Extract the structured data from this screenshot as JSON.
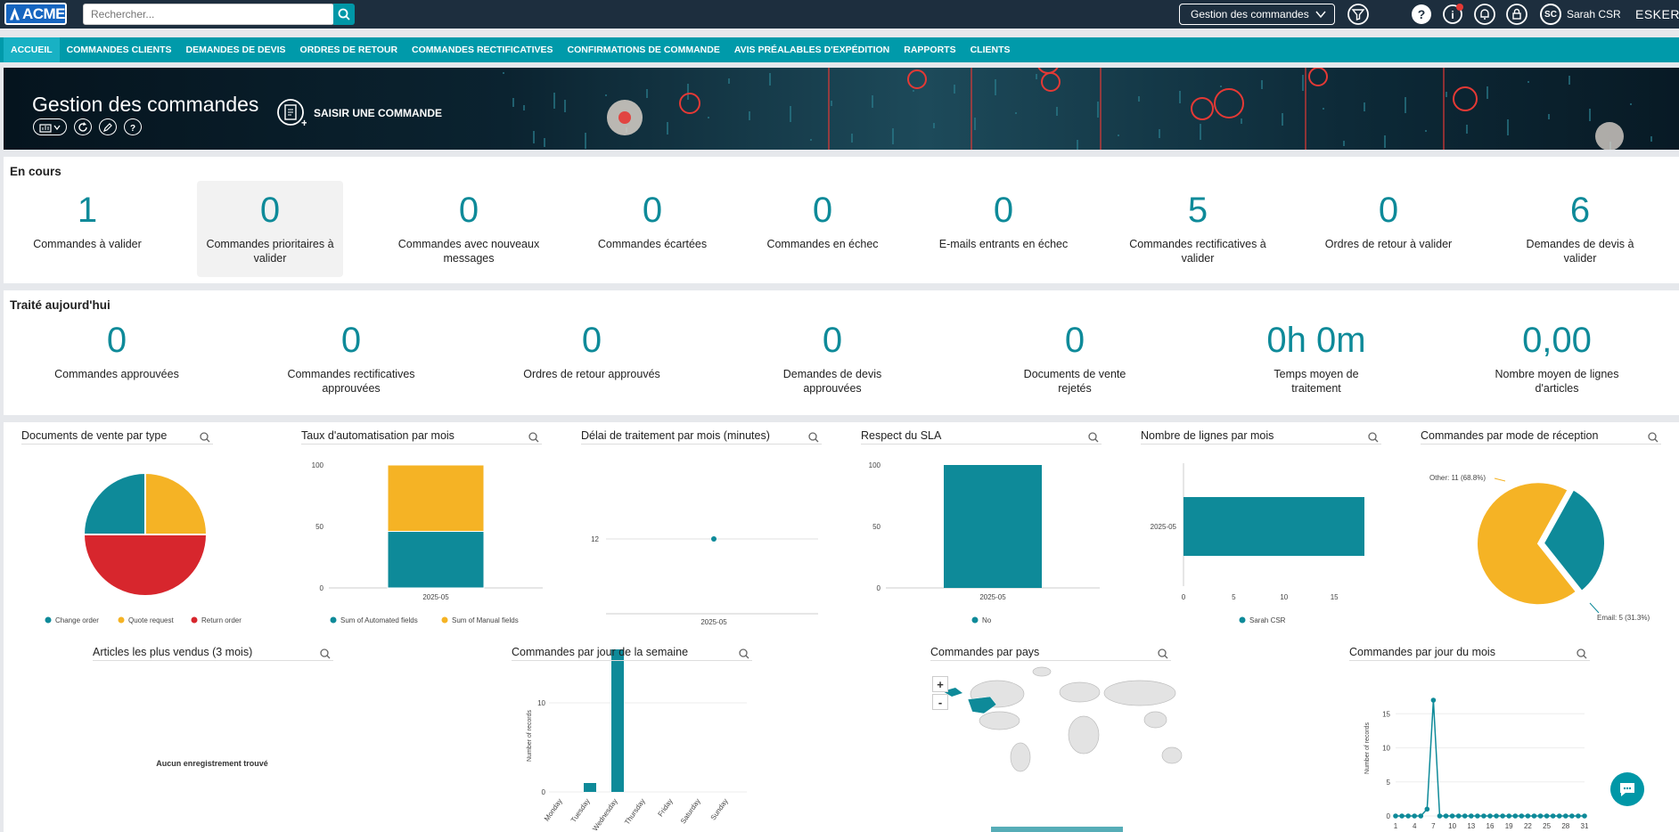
{
  "header": {
    "logo_text": "ACME",
    "search_placeholder": "Rechercher...",
    "app_selector": "Gestion des commandes",
    "user_initials": "SC",
    "user_name": "Sarah CSR",
    "brand": "ESKER"
  },
  "nav": {
    "items": [
      "ACCUEIL",
      "COMMANDES CLIENTS",
      "DEMANDES DE DEVIS",
      "ORDRES DE RETOUR",
      "COMMANDES RECTIFICATIVES",
      "CONFIRMATIONS DE COMMANDE",
      "AVIS PRÉALABLES D'EXPÉDITION",
      "RAPPORTS",
      "CLIENTS"
    ],
    "active_index": 0
  },
  "banner": {
    "title": "Gestion des commandes",
    "action_label": "SAISIR UNE COMMANDE"
  },
  "en_cours": {
    "title": "En cours",
    "kpis": [
      {
        "value": "1",
        "label": "Commandes à valider"
      },
      {
        "value": "0",
        "label": "Commandes prioritaires à valider"
      },
      {
        "value": "0",
        "label": "Commandes avec nouveaux messages"
      },
      {
        "value": "0",
        "label": "Commandes écartées"
      },
      {
        "value": "0",
        "label": "Commandes en échec"
      },
      {
        "value": "0",
        "label": "E-mails entrants en échec"
      },
      {
        "value": "5",
        "label": "Commandes rectificatives à valider"
      },
      {
        "value": "0",
        "label": "Ordres de retour à valider"
      },
      {
        "value": "6",
        "label": "Demandes de devis à valider"
      }
    ]
  },
  "traite": {
    "title": "Traité aujourd'hui",
    "kpis": [
      {
        "value": "0",
        "label": "Commandes approuvées"
      },
      {
        "value": "0",
        "label": "Commandes rectificatives approuvées"
      },
      {
        "value": "0",
        "label": "Ordres de retour approuvés"
      },
      {
        "value": "0",
        "label": "Demandes de devis approuvées"
      },
      {
        "value": "0",
        "label": "Documents de vente rejetés"
      },
      {
        "value": "0h 0m",
        "label": "Temps moyen de traitement"
      },
      {
        "value": "0,00",
        "label": "Nombre moyen de lignes d'articles"
      }
    ]
  },
  "charts": {
    "c1": {
      "title": "Documents de vente par type"
    },
    "c2": {
      "title": "Taux d'automatisation par mois"
    },
    "c3": {
      "title": "Délai de traitement par mois (minutes)"
    },
    "c4": {
      "title": "Respect du SLA"
    },
    "c5": {
      "title": "Nombre de lignes par mois"
    },
    "c6": {
      "title": "Commandes par mode de réception"
    },
    "c7": {
      "title": "Articles les plus vendus (3 mois)",
      "empty": "Aucun enregistrement trouvé"
    },
    "c8": {
      "title": "Commandes par jour de la semaine"
    },
    "c9": {
      "title": "Commandes par pays"
    },
    "c10": {
      "title": "Commandes par jour du mois"
    }
  },
  "colors": {
    "teal": "#0e8a99",
    "yellow": "#f5b325",
    "red": "#d7262d",
    "nav": "#009aaa",
    "topbar": "#1d2e3e"
  },
  "chart_data": [
    {
      "type": "pie",
      "title": "Documents de vente par type",
      "categories": [
        "Change order",
        "Quote request",
        "Return order"
      ],
      "values": [
        25,
        25,
        50
      ],
      "colors": [
        "#0e8a99",
        "#f5b325",
        "#d7262d"
      ],
      "legend": "bottom"
    },
    {
      "type": "bar",
      "title": "Taux d'automatisation par mois",
      "categories": [
        "2025-05"
      ],
      "series": [
        {
          "name": "Sum of Automated fields",
          "values": [
            46
          ]
        },
        {
          "name": "Sum of Manual fields",
          "values": [
            54
          ]
        }
      ],
      "stacked": true,
      "ylim": [
        0,
        100
      ],
      "yticks": [
        0,
        50,
        100
      ],
      "legend": "bottom"
    },
    {
      "type": "line",
      "title": "Délai de traitement par mois (minutes)",
      "categories": [
        "2025-05"
      ],
      "values": [
        12
      ],
      "yticks": [
        12
      ]
    },
    {
      "type": "bar",
      "title": "Respect du SLA",
      "categories": [
        "2025-05"
      ],
      "series": [
        {
          "name": "No",
          "values": [
            100
          ]
        }
      ],
      "ylim": [
        0,
        100
      ],
      "yticks": [
        0,
        50,
        100
      ],
      "legend": "bottom"
    },
    {
      "type": "bar",
      "title": "Nombre de lignes par mois",
      "orientation": "horizontal",
      "categories": [
        "2025-05"
      ],
      "series": [
        {
          "name": "Sarah CSR",
          "values": [
            18
          ]
        }
      ],
      "xlim": [
        0,
        18
      ],
      "xticks": [
        0,
        5,
        10,
        15
      ],
      "legend": "bottom"
    },
    {
      "type": "pie",
      "title": "Commandes par mode de réception",
      "categories": [
        "Other",
        "Email"
      ],
      "values": [
        11,
        5
      ],
      "labels": [
        "Other: 11 (68.8%)",
        "Email: 5 (31.3%)"
      ],
      "colors": [
        "#f5b325",
        "#0e8a99"
      ]
    },
    {
      "type": "bar",
      "title": "Commandes par jour de la semaine",
      "categories": [
        "Monday",
        "Tuesday",
        "Wednesday",
        "Thursday",
        "Friday",
        "Saturday",
        "Sunday"
      ],
      "values": [
        0,
        1,
        16,
        0,
        0,
        0,
        0
      ],
      "ylabel": "Number of records",
      "ylim": [
        0,
        17
      ],
      "yticks": [
        0,
        10
      ]
    },
    {
      "type": "line",
      "title": "Commandes par jour du mois",
      "x": [
        1,
        2,
        3,
        4,
        5,
        6,
        7,
        8,
        9,
        10,
        11,
        12,
        13,
        14,
        15,
        16,
        17,
        18,
        19,
        20,
        21,
        22,
        23,
        24,
        25,
        26,
        27,
        28,
        29,
        30,
        31
      ],
      "values": [
        0,
        0,
        0,
        0,
        0,
        1,
        17,
        0,
        0,
        0,
        0,
        0,
        0,
        0,
        0,
        0,
        0,
        0,
        0,
        0,
        0,
        0,
        0,
        0,
        0,
        0,
        0,
        0,
        0,
        0,
        0
      ],
      "ylabel": "Number of records",
      "yticks": [
        0,
        5,
        10,
        15
      ],
      "xticks": [
        1,
        4,
        7,
        10,
        13,
        16,
        19,
        22,
        25,
        28,
        31
      ],
      "ylim": [
        0,
        17
      ]
    }
  ]
}
